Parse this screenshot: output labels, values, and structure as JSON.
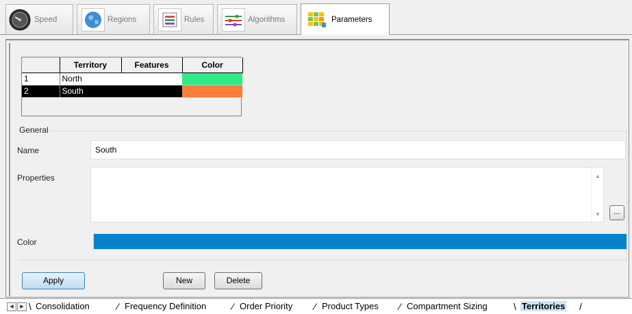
{
  "top_tabs": [
    {
      "label": "Speed",
      "icon": "speedometer-icon"
    },
    {
      "label": "Regions",
      "icon": "globe-icon"
    },
    {
      "label": "Rules",
      "icon": "rules-list-icon"
    },
    {
      "label": "Algorithms",
      "icon": "algorithm-lines-icon"
    },
    {
      "label": "Parameters",
      "icon": "parameters-grid-icon"
    }
  ],
  "grid": {
    "columns": [
      "Territory",
      "Features",
      "Color"
    ],
    "rows": [
      {
        "num": "1",
        "territory": "North",
        "features": "",
        "color": "#33e986"
      },
      {
        "num": "2",
        "territory": "South",
        "features": "",
        "color": "#fb7e3d"
      }
    ]
  },
  "general": {
    "title": "General",
    "name_label": "Name",
    "name_value": "South",
    "properties_label": "Properties",
    "properties_value": "",
    "ellipsis_label": "...",
    "color_label": "Color",
    "color_value": "#0581c9"
  },
  "buttons": {
    "apply": "Apply",
    "new": "New",
    "delete": "Delete"
  },
  "sheet_tabs": [
    {
      "label": "Consolidation"
    },
    {
      "label": "Frequency Definition"
    },
    {
      "label": "Order Priority"
    },
    {
      "label": "Product Types"
    },
    {
      "label": "Compartment Sizing"
    },
    {
      "label": "Territories"
    }
  ]
}
